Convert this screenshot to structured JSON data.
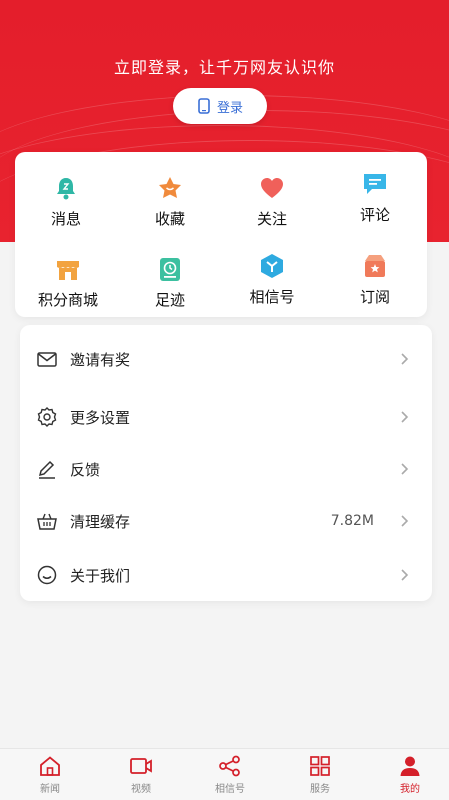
{
  "header": {
    "prompt": "立即登录，让千万网友认识你",
    "login_label": "登录"
  },
  "grid": {
    "items": [
      {
        "label": "消息",
        "icon": "bell-icon",
        "color": "#2fb7a6"
      },
      {
        "label": "收藏",
        "icon": "star-icon",
        "color": "#f08a3c"
      },
      {
        "label": "关注",
        "icon": "heart-icon",
        "color": "#f0605a"
      },
      {
        "label": "评论",
        "icon": "comment-icon",
        "color": "#38b6e8"
      },
      {
        "label": "积分商城",
        "icon": "store-icon",
        "color": "#f2a340"
      },
      {
        "label": "足迹",
        "icon": "footprint-icon",
        "color": "#3cc0a0"
      },
      {
        "label": "相信号",
        "icon": "xiangxin-icon",
        "color": "#2eaae0"
      },
      {
        "label": "订阅",
        "icon": "subscribe-icon",
        "color": "#f07a5a"
      }
    ]
  },
  "list": {
    "items": [
      {
        "label": "邀请有奖",
        "icon": "mail-icon",
        "value": ""
      },
      {
        "label": "更多设置",
        "icon": "gear-icon",
        "value": ""
      },
      {
        "label": "反馈",
        "icon": "pencil-icon",
        "value": ""
      },
      {
        "label": "清理缓存",
        "icon": "basket-icon",
        "value": "7.82M"
      },
      {
        "label": "关于我们",
        "icon": "smile-icon",
        "value": ""
      }
    ]
  },
  "tabbar": {
    "tabs": [
      {
        "label": "新闻",
        "icon": "home-icon",
        "active": false
      },
      {
        "label": "视频",
        "icon": "video-icon",
        "active": false
      },
      {
        "label": "相信号",
        "icon": "share-icon",
        "active": false
      },
      {
        "label": "服务",
        "icon": "grid-icon",
        "active": false
      },
      {
        "label": "我的",
        "icon": "user-icon",
        "active": true
      }
    ]
  },
  "colors": {
    "brand_red": "#e41e2b",
    "link_blue": "#3a6fd6",
    "active_tab": "#d4202a"
  }
}
